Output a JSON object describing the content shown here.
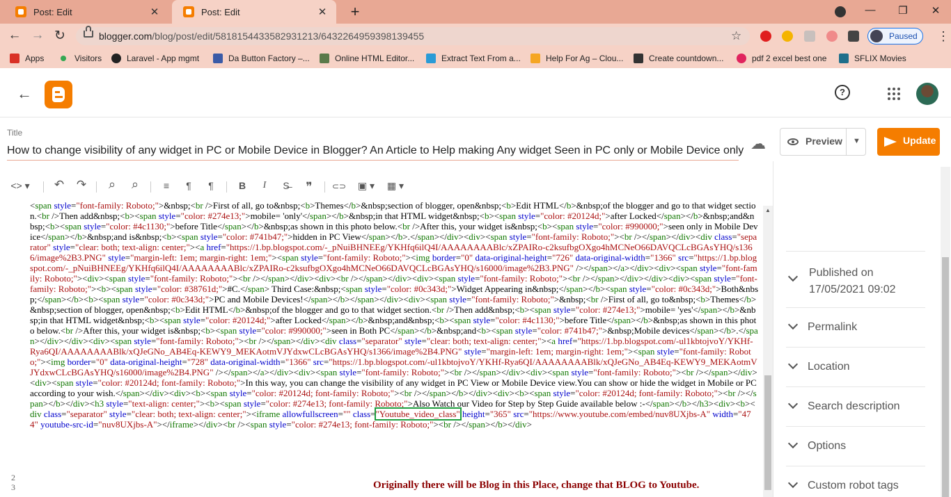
{
  "browser": {
    "tabs": [
      {
        "label": "Post: Edit",
        "close": "✕"
      },
      {
        "label": "Post: Edit",
        "close": "✕"
      }
    ],
    "new_tab": "+",
    "window_controls": {
      "minimize": "—",
      "restore": "❐",
      "close": "✕"
    },
    "nav": {
      "back": "←",
      "forward": "→",
      "reload": "↻"
    },
    "url_host": "blogger.com",
    "url_path": "/blog/post/edit/5818154433582931213/6432264959398139455",
    "star": "☆",
    "profile_status": "Paused",
    "kebab": "⋮",
    "bookmarks": [
      {
        "label": "Apps",
        "color": "#d93025"
      },
      {
        "label": "Visitors",
        "color": "#34a853"
      },
      {
        "label": "Laravel - App mgmt",
        "color": "#222222"
      },
      {
        "label": "Da Button Factory –...",
        "color": "#3b5ba7"
      },
      {
        "label": "Online HTML Editor...",
        "color": "#5a7a4a"
      },
      {
        "label": "Extract Text From a...",
        "color": "#2a9bd6"
      },
      {
        "label": "Help For Ag – Clou...",
        "color": "#f5a623"
      },
      {
        "label": "Create countdown...",
        "color": "#333333"
      },
      {
        "label": "pdf 2 excel best one",
        "color": "#e0245e"
      },
      {
        "label": "SFLIX Movies",
        "color": "#1f6f8b"
      }
    ]
  },
  "app": {
    "back": "←",
    "help": "?",
    "title_label": "Title",
    "post_title": "How to change visibility of any widget in PC or Mobile Device in Blogger? An Article to Help making Any widget Seen in PC only or Mobile Device only",
    "cloud": "☁",
    "preview_label": "Preview",
    "preview_caret": "▼",
    "update_label": "Update",
    "accent": "#f57d00"
  },
  "toolbar": [
    "<> ▾",
    "↶",
    "↷",
    "⌕",
    "⌕",
    "≡",
    "¶",
    "¶",
    "B",
    "I",
    "S̶",
    "❞",
    "⊂⊃",
    "▣ ▾",
    "▦ ▾"
  ],
  "editor": {
    "line_numbers": [
      "2",
      "3"
    ],
    "code_html": "&lt;<span class=t>span</span> <span class=a>style</span>=<span class=v>\"font-family: Roboto;\"</span>&gt;&amp;nbsp;&lt;<span class=t>br</span> /&gt;First of all, go to&amp;nbsp;&lt;<span class=t>b</span>&gt;Themes&lt;/<span class=t>b</span>&gt;&amp;nbsp;section of blogger, open&amp;nbsp;&lt;<span class=t>b</span>&gt;Edit HTML&lt;/<span class=t>b</span>&gt;&amp;nbsp;of the blogger and go to that widget section.&lt;<span class=t>br</span> /&gt;Then add&amp;nbsp;&lt;<span class=t>b</span>&gt;&lt;<span class=t>span</span> <span class=a>style</span>=<span class=v>\"color: #274e13;\"</span>&gt;mobile= 'only'&lt;/<span class=t>span</span>&gt;&lt;/<span class=t>b</span>&gt;&amp;nbsp;in that HTML widget&amp;nbsp;&lt;<span class=t>b</span>&gt;&lt;<span class=t>span</span> <span class=a>style</span>=<span class=v>\"color: #20124d;\"</span>&gt;after Locked&lt;/<span class=t>span</span>&gt;&lt;/<span class=t>b</span>&gt;&amp;nbsp;and&amp;nbsp;&lt;<span class=t>b</span>&gt;&lt;<span class=t>span</span> <span class=a>style</span>=<span class=v>\"color: #4c1130;\"</span>&gt;before Title&lt;/<span class=t>span</span>&gt;&lt;/<span class=t>b</span>&gt;&amp;nbsp;as shown in this photo below.&lt;<span class=t>br</span> /&gt;After this, your widget is&amp;nbsp;&lt;<span class=t>b</span>&gt;&lt;<span class=t>span</span> <span class=a>style</span>=<span class=v>\"color: #990000;\"</span>&gt;seen only in Mobile Device&lt;/<span class=t>span</span>&gt;&lt;/<span class=t>b</span>&gt;&amp;nbsp;and is&amp;nbsp;&lt;<span class=t>b</span>&gt;&lt;<span class=t>span</span> <span class=a>style</span>=<span class=v>\"color: #741b47;\"</span>&gt;hidden in PC View&lt;/<span class=t>span</span>&gt;&lt;/<span class=t>b</span>&gt;.&lt;/<span class=t>span</span>&gt;&lt;/<span class=t>div</span>&gt;&lt;<span class=t>div</span>&gt;&lt;<span class=t>span</span> <span class=a>style</span>=<span class=v>\"font-family: Roboto;\"</span>&gt;&lt;<span class=t>br</span> /&gt;&lt;/<span class=t>span</span>&gt;&lt;/<span class=t>div</span>&gt;&lt;<span class=t>div</span> <span class=a>class</span>=<span class=v>\"separator\"</span> <span class=a>style</span>=<span class=v>\"clear: both; text-align: center;\"</span>&gt;&lt;<span class=t>a</span> <span class=a>href</span>=<span class=v>\"https://1.bp.blogspot.com/-_pNuiBHNEEg/YKHfq6ilQ4I/AAAAAAAABlc/xZPAIRo-c2ksufbgOXgo4hMCNeO66DAVQCLcBGAsYHQ/s1366/image%2B3.PNG\"</span> <span class=a>style</span>=<span class=v>\"margin-left: 1em; margin-right: 1em;\"</span>&gt;&lt;<span class=t>span</span> <span class=a>style</span>=<span class=v>\"font-family: Roboto;\"</span>&gt;&lt;<span class=t>img</span> <span class=a>border</span>=<span class=v>\"0\"</span> <span class=a>data-original-height</span>=<span class=v>\"726\"</span> <span class=a>data-original-width</span>=<span class=v>\"1366\"</span> <span class=a>src</span>=<span class=v>\"https://1.bp.blogspot.com/-_pNuiBHNEEg/YKHfq6ilQ4I/AAAAAAAABlc/xZPAIRo-c2ksufbgOXgo4hMCNeO66DAVQCLcBGAsYHQ/s16000/image%2B3.PNG\"</span> /&gt;&lt;/<span class=t>span</span>&gt;&lt;/<span class=t>a</span>&gt;&lt;/<span class=t>div</span>&gt;&lt;<span class=t>div</span>&gt;&lt;<span class=t>span</span> <span class=a>style</span>=<span class=v>\"font-family: Roboto;\"</span>&gt;&lt;<span class=t>div</span>&gt;&lt;<span class=t>span</span> <span class=a>style</span>=<span class=v>\"font-family: Roboto;\"</span>&gt;&lt;<span class=t>br</span> /&gt;&lt;/<span class=t>span</span>&gt;&lt;/<span class=t>div</span>&gt;&lt;<span class=t>div</span>&gt;&lt;<span class=t>br</span> /&gt;&lt;/<span class=t>span</span>&gt;&lt;/<span class=t>div</span>&gt;&lt;<span class=t>div</span>&gt;&lt;<span class=t>span</span> <span class=a>style</span>=<span class=v>\"font-family: Roboto;\"</span>&gt;&lt;<span class=t>br</span> /&gt;&lt;/<span class=t>span</span>&gt;&lt;/<span class=t>div</span>&gt;&lt;/<span class=t>div</span>&gt;&lt;<span class=t>div</span>&gt;&lt;<span class=t>span</span> <span class=a>style</span>=<span class=v>\"font-family: Roboto;\"</span>&gt;&lt;<span class=t>b</span>&gt;&lt;<span class=t>span</span> <span class=a>style</span>=<span class=v>\"color: #38761d;\"</span>&gt;#C.&lt;/<span class=t>span</span>&gt; Third Case:&amp;nbsp;&lt;<span class=t>span</span> <span class=a>style</span>=<span class=v>\"color: #0c343d;\"</span>&gt;Widget Appearing in&amp;nbsp;&lt;/<span class=t>span</span>&gt;&lt;/<span class=t>b</span>&gt;&lt;<span class=t>span</span> <span class=a>style</span>=<span class=v>\"color: #0c343d;\"</span>&gt;Both&amp;nbsp;&lt;/<span class=t>span</span>&gt;&lt;/<span class=t>b</span>&gt;&lt;<span class=t>b</span>&gt;&lt;<span class=t>span</span> <span class=a>style</span>=<span class=v>\"color: #0c343d;\"</span>&gt;PC and Mobile Devices!&lt;/<span class=t>span</span>&gt;&lt;/<span class=t>b</span>&gt;&lt;/<span class=t>span</span>&gt;&lt;/<span class=t>div</span>&gt;&lt;<span class=t>div</span>&gt;&lt;<span class=t>span</span> <span class=a>style</span>=<span class=v>\"font-family: Roboto;\"</span>&gt;&amp;nbsp;&lt;<span class=t>br</span> /&gt;First of all, go to&amp;nbsp;&lt;<span class=t>b</span>&gt;Themes&lt;/<span class=t>b</span>&gt;&amp;nbsp;section of blogger, open&amp;nbsp;&lt;<span class=t>b</span>&gt;Edit HTML&lt;/<span class=t>b</span>&gt;&amp;nbsp;of the blogger and go to that widget section.&lt;<span class=t>br</span> /&gt;Then add&amp;nbsp;&lt;<span class=t>b</span>&gt;&lt;<span class=t>span</span> <span class=a>style</span>=<span class=v>\"color: #274e13;\"</span>&gt;mobile= 'yes'&lt;/<span class=t>span</span>&gt;&lt;/<span class=t>b</span>&gt;&amp;nbsp;in that HTML widget&amp;nbsp;&lt;<span class=t>b</span>&gt;&lt;<span class=t>span</span> <span class=a>style</span>=<span class=v>\"color: #20124d;\"</span>&gt;after Locked&lt;/<span class=t>span</span>&gt;&lt;/<span class=t>b</span>&gt;&amp;nbsp;and&amp;nbsp;&lt;<span class=t>b</span>&gt;&lt;<span class=t>span</span> <span class=a>style</span>=<span class=v>\"color: #4c1130;\"</span>&gt;before Title&lt;/<span class=t>span</span>&gt;&lt;/<span class=t>b</span>&gt;&amp;nbsp;as shown in this photo below.&lt;<span class=t>br</span> /&gt;After this, your widget is&amp;nbsp;&lt;<span class=t>b</span>&gt;&lt;<span class=t>span</span> <span class=a>style</span>=<span class=v>\"color: #990000;\"</span>&gt;seen in Both PC&lt;/<span class=t>span</span>&gt;&lt;/<span class=t>b</span>&gt;&amp;nbsp;and&lt;<span class=t>b</span>&gt;&lt;<span class=t>span</span> <span class=a>style</span>=<span class=v>\"color: #741b47;\"</span>&gt;&amp;nbsp;Mobile devices&lt;/<span class=t>span</span>&gt;&lt;/<span class=t>b</span>&gt;.&lt;/<span class=t>span</span>&gt;&lt;/<span class=t>div</span>&gt;&lt;/<span class=t>div</span>&gt;&lt;<span class=t>div</span>&gt;&lt;<span class=t>span</span> <span class=a>style</span>=<span class=v>\"font-family: Roboto;\"</span>&gt;&lt;<span class=t>br</span> /&gt;&lt;/<span class=t>span</span>&gt;&lt;/<span class=t>div</span>&gt;&lt;<span class=t>div</span> <span class=a>class</span>=<span class=v>\"separator\"</span> <span class=a>style</span>=<span class=v>\"clear: both; text-align: center;\"</span>&gt;&lt;<span class=t>a</span> <span class=a>href</span>=<span class=v>\"https://1.bp.blogspot.com/-ul1kbtojvoY/YKHf-Rya6QI/AAAAAAAABlk/xQJeGNo_AB4Eq-KEWY9_MEKAotmVJYdxwCLcBGAsYHQ/s1366/image%2B4.PNG\"</span> <span class=a>style</span>=<span class=v>\"margin-left: 1em; margin-right: 1em;\"</span>&gt;&lt;<span class=t>span</span> <span class=a>style</span>=<span class=v>\"font-family: Roboto;\"</span>&gt;&lt;<span class=t>img</span> <span class=a>border</span>=<span class=v>\"0\"</span> <span class=a>data-original-height</span>=<span class=v>\"728\"</span> <span class=a>data-original-width</span>=<span class=v>\"1366\"</span> <span class=a>src</span>=<span class=v>\"https://1.bp.blogspot.com/-ul1kbtojvoY/YKHf-Rya6QI/AAAAAAAABlk/xQJeGNo_AB4Eq-KEWY9_MEKAotmVJYdxwCLcBGAsYHQ/s16000/image%2B4.PNG\"</span> /&gt;&lt;/<span class=t>span</span>&gt;&lt;/<span class=t>a</span>&gt;&lt;/<span class=t>div</span>&gt;&lt;<span class=t>div</span>&gt;&lt;<span class=t>span</span> <span class=a>style</span>=<span class=v>\"font-family: Roboto;\"</span>&gt;&lt;<span class=t>br</span> /&gt;&lt;/<span class=t>span</span>&gt;&lt;/<span class=t>div</span>&gt;&lt;<span class=t>div</span>&gt;&lt;<span class=t>span</span> <span class=a>style</span>=<span class=v>\"font-family: Roboto;\"</span>&gt;&lt;<span class=t>br</span> /&gt;&lt;/<span class=t>span</span>&gt;&lt;/<span class=t>div</span>&gt;&lt;<span class=t>div</span>&gt;&lt;<span class=t>span</span> <span class=a>style</span>=<span class=v>\"color: #20124d; font-family: Roboto;\"</span>&gt;In this way, you can change the visibility of any widget in PC View or Mobile Device view.You can show or hide the widget in Mobile or PC according to your wish.&lt;/<span class=t>span</span>&gt;&lt;/<span class=t>div</span>&gt;&lt;<span class=t>div</span>&gt;&lt;<span class=t>b</span>&gt;&lt;<span class=t>span</span> <span class=a>style</span>=<span class=v>\"color: #20124d; font-family: Roboto;\"</span>&gt;&lt;<span class=t>br</span> /&gt;&lt;/<span class=t>span</span>&gt;&lt;/<span class=t>b</span>&gt;&lt;/<span class=t>div</span>&gt;&lt;<span class=t>div</span>&gt;&lt;<span class=t>b</span>&gt;&lt;<span class=t>span</span> <span class=a>style</span>=<span class=v>\"color: #20124d; font-family: Roboto;\"</span>&gt;&lt;<span class=t>br</span> /&gt;&lt;/<span class=t>span</span>&gt;&lt;/<span class=t>b</span>&gt;&lt;/<span class=t>div</span>&gt;&lt;<span class=t>h3</span> <span class=a>style</span>=<span class=v>\"text-align: center;\"</span>&gt;&lt;<span class=t>b</span>&gt;&lt;<span class=t>span</span> <span class=a>style</span>=<span class=v>\"color: #274e13; font-family: Roboto;\"</span>&gt;Also Watch our Video for Step by Step Guide available below :-&lt;/<span class=t>span</span>&gt;&lt;/<span class=t>b</span>&gt;&lt;/<span class=t>h3</span>&gt;&lt;<span class=t>div</span>&gt;&lt;<span class=t>b</span>&gt;&lt;<span class=t>div</span> <span class=a>class</span>=<span class=v>\"separator\"</span> <span class=a>style</span>=<span class=v>\"clear: both; text-align: center;\"</span>&gt;&lt;<span class=t>iframe</span> <span class=a>allowfullscreen</span>=<span class=v>\"\"</span> <span class=a>class</span>=<span class='v hl'>\"Youtube_video_class\"</span> <span class=a>height</span>=<span class=v>\"365\"</span> <span class=a>src</span>=<span class=v>\"https://www.youtube.com/embed/nuv8UXjbs-A\"</span> <span class=a>width</span>=<span class=v>\"474\"</span> <span class=a>youtube-src-id</span>=<span class=v>\"nuv8UXjbs-A\"</span>&gt;&lt;/<span class=t>iframe</span>&gt;&lt;/<span class=t>div</span>&gt;&lt;<span class=t>br</span> /&gt;&lt;<span class=t>span</span> <span class=a>style</span>=<span class=v>\"color: #274e13; font-family: Roboto;\"</span>&gt;&lt;<span class=t>br</span> /&gt;&lt;/<span class=t>span</span>&gt;&lt;/<span class=t>b</span>&gt;&lt;/<span class=t>div</span>&gt;",
    "note": "Originally there will be Blog in this Place, change that BLOG to Youtube."
  },
  "sidebar": {
    "published_label": "Published on",
    "published_date": "17/05/2021 09:02",
    "items": [
      "Permalink",
      "Location",
      "Search description",
      "Options",
      "Custom robot tags"
    ]
  }
}
